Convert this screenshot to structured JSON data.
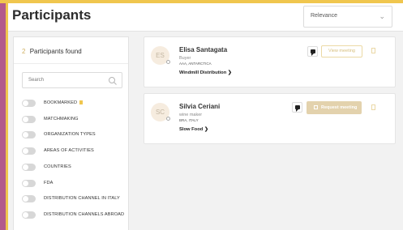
{
  "header": {
    "title": "Participants",
    "sort": {
      "selected": "Relevance",
      "icon": "chevron-down-icon"
    }
  },
  "sidebar": {
    "found_count": "2",
    "found_label": "Participants found",
    "search_placeholder": "Search",
    "filters": [
      {
        "label": "BOOKMARKED",
        "enabled": false
      },
      {
        "label": "MATCHMAKING",
        "enabled": false
      },
      {
        "label": "ORGANIZATION TYPES",
        "enabled": false
      },
      {
        "label": "AREAS OF ACTIVITIES",
        "enabled": false
      },
      {
        "label": "COUNTRIES",
        "enabled": false
      },
      {
        "label": "FDA",
        "enabled": false
      },
      {
        "label": "DISTRIBUTION CHANNEL IN ITALY",
        "enabled": false
      },
      {
        "label": "DISTRIBUTION CHANNELS ABROAD",
        "enabled": false
      }
    ]
  },
  "participants": [
    {
      "initials": "ES",
      "name": "Elisa Santagata",
      "role": "Buyer",
      "location": "AAA, ANTARCTICA",
      "organization": "Windmill Distribution",
      "action_label": "View meeting"
    },
    {
      "initials": "SC",
      "name": "Silvia Ceriani",
      "role": "wine maker",
      "location": "BRA, ITALY",
      "organization": "Slow Food",
      "action_label": "Request meeting"
    }
  ],
  "colors": {
    "accent": "#f0c64e",
    "border": "#b35a8c",
    "avatar_bg": "#f6ecdf"
  }
}
